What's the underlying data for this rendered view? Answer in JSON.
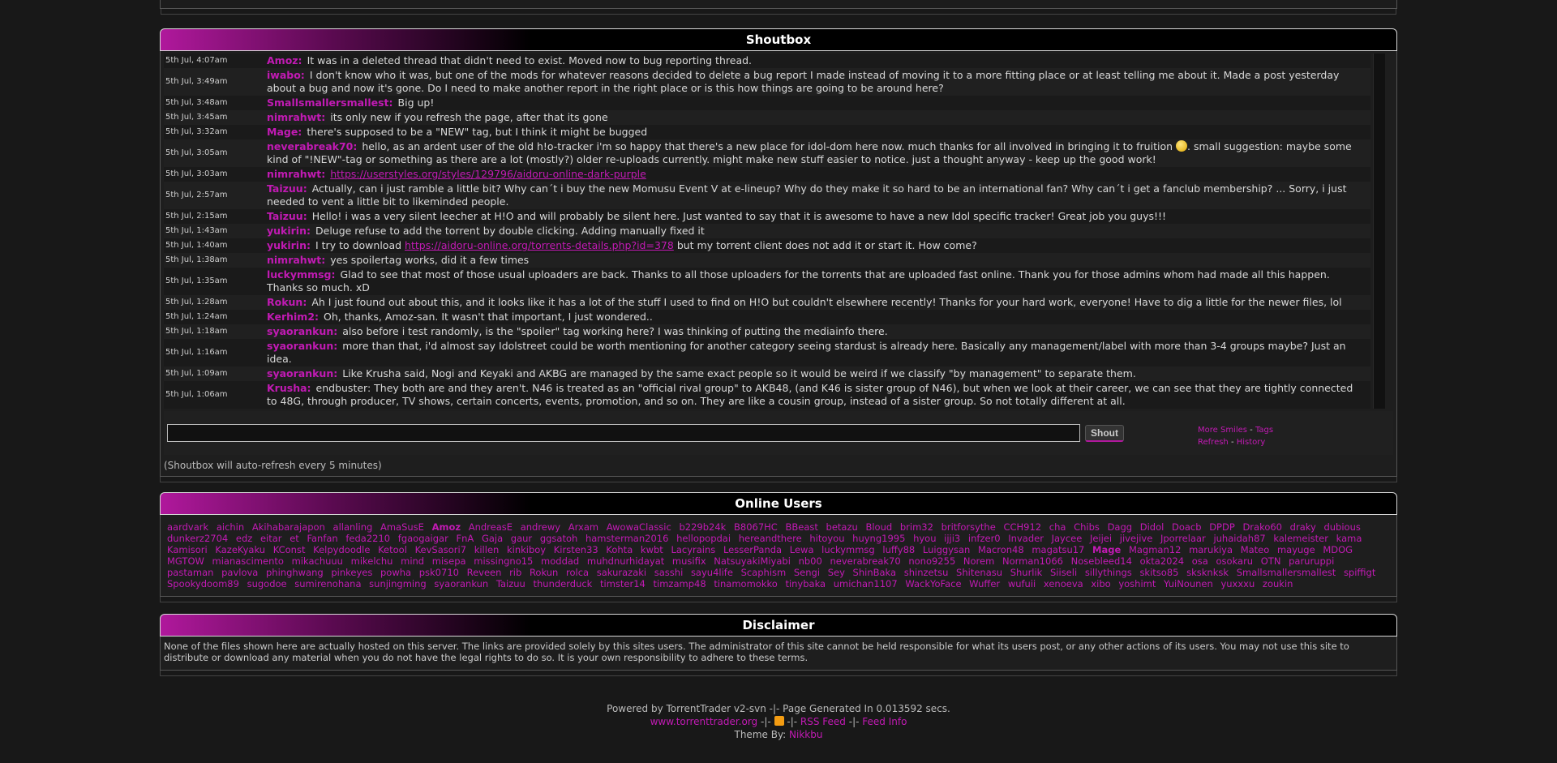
{
  "shoutbox": {
    "title": "Shoutbox",
    "messages": [
      {
        "time": "5th Jul, 4:07am",
        "user": "Amoz:",
        "text": "It was in a deleted thread that didn't need to exist. Moved now to bug reporting thread."
      },
      {
        "time": "5th Jul, 3:49am",
        "user": "iwabo:",
        "text": "I don't know who it was, but one of the mods for whatever reasons decided to delete a bug report I made instead of moving it to a more fitting place or at least telling me about it. Made a post yesterday about a bug and now it's gone. Do I need to make another report in the right place or is this how things are going to be around here?"
      },
      {
        "time": "5th Jul, 3:48am",
        "user": "Smallsmallersmallest:",
        "text": "Big up!"
      },
      {
        "time": "5th Jul, 3:45am",
        "user": "nimrahwt:",
        "text": "its only new if you refresh the page, after that its gone"
      },
      {
        "time": "5th Jul, 3:32am",
        "user": "Mage:",
        "text": "there's supposed to be a \"NEW\" tag, but I think it might be bugged"
      },
      {
        "time": "5th Jul, 3:05am",
        "user": "neverabreak70:",
        "text": "hello, as an ardent user of the old h!o-tracker i'm so happy that there's a new place for idol-dom here now. much thanks for all involved in bringing it to fruition",
        "text_after": ". small suggestion: maybe some kind of \"!NEW\"-tag or something as there are a lot (mostly?) older re-uploads currently. might make new stuff easier to notice. just a thought anyway - keep up the good work!"
      },
      {
        "time": "5th Jul, 3:03am",
        "user": "nimrahwt:",
        "link": "https://userstyles.org/styles/129796/aidoru-online-dark-purple"
      },
      {
        "time": "5th Jul, 2:57am",
        "user": "Taizuu:",
        "text": "Actually, can i just ramble a little bit? Why can´t i buy the new Momusu Event V at e-lineup? Why do they make it so hard to be an international fan? Why can´t i get a fanclub membership? ... Sorry, i just needed to vent a little bit to likeminded people."
      },
      {
        "time": "5th Jul, 2:15am",
        "user": "Taizuu:",
        "text": "Hello! i was a very silent leecher at H!O and will probably be silent here. Just wanted to say that it is awesome to have a new Idol specific tracker! Great job you guys!!!"
      },
      {
        "time": "5th Jul, 1:43am",
        "user": "yukirin:",
        "text": "Deluge refuse to add the torrent by double clicking. Adding manually fixed it"
      },
      {
        "time": "5th Jul, 1:40am",
        "user": "yukirin:",
        "text": "I try to download",
        "link": "https://aidoru-online.org/torrents-details.php?id=378",
        "text_after": "but my torrent client does not add it or start it. How come?"
      },
      {
        "time": "5th Jul, 1:38am",
        "user": "nimrahwt:",
        "text": "yes spoilertag works, did it a few times"
      },
      {
        "time": "5th Jul, 1:35am",
        "user": "luckymmsg:",
        "text": "Glad to see that most of those usual uploaders are back. Thanks to all those uploaders for the torrents that are uploaded fast online. Thank you for those admins whom had made all this happen. Thanks so much. xD"
      },
      {
        "time": "5th Jul, 1:28am",
        "user": "Rokun:",
        "text": "Ah I just found out about this, and it looks like it has a lot of the stuff I used to find on H!O but couldn't elsewhere recently! Thanks for your hard work, everyone! Have to dig a little for the newer files, lol"
      },
      {
        "time": "5th Jul, 1:24am",
        "user": "Kerhim2:",
        "text": "Oh, thanks, Amoz-san. It wasn't that important, I just wondered.."
      },
      {
        "time": "5th Jul, 1:18am",
        "user": "syaorankun:",
        "text": "also before i test randomly, is the \"spoiler\" tag working here? I was thinking of putting the mediainfo there."
      },
      {
        "time": "5th Jul, 1:16am",
        "user": "syaorankun:",
        "text": "more than that, i'd almost say Idolstreet could be worth mentioning for another category seeing stardust is already here. Basically any management/label with more than 3-4 groups maybe? Just an idea."
      },
      {
        "time": "5th Jul, 1:09am",
        "user": "syaorankun:",
        "text": "Like Krusha said, Nogi and Keyaki and AKBG are managed by the same exact people so it would be weird if we classify \"by management\" to separate them."
      },
      {
        "time": "5th Jul, 1:06am",
        "user": "Krusha:",
        "text": "endbuster: They both are and they aren't. N46 is treated as an \"official rival group\" to AKB48, (and K46 is sister group of N46), but when we look at their career, we can see that they are tightly connected to 48G, through producer, TV shows, certain concerts, events, promotion, and so on. They are like a cousin group, instead of a sister group. So not totally different at all."
      }
    ],
    "shout_button": "Shout",
    "links": {
      "more_smiles": "More Smiles",
      "dash1": "-",
      "tags": "Tags",
      "refresh": "Refresh",
      "dash2": "-",
      "history": "History"
    },
    "note": "(Shoutbox will auto-refresh every 5 minutes)"
  },
  "online_users": {
    "title": "Online Users",
    "users": [
      "aardvark",
      "aichin",
      "Akihabarajapon",
      "allanling",
      "AmaSusE",
      "Amoz",
      "AndreasE",
      "andrewy",
      "Arxam",
      "AwowaClassic",
      "b229b24k",
      "B8067HC",
      "BBeast",
      "betazu",
      "Bloud",
      "brim32",
      "britforsythe",
      "CCH912",
      "cha",
      "Chibs",
      "Dagg",
      "Didol",
      "Doacb",
      "DPDP",
      "Drako60",
      "draky",
      "dubious",
      "dunkerz2704",
      "edz",
      "eitar",
      "et",
      "Fanfan",
      "feda2210",
      "fgaogaigar",
      "FnA",
      "Gaja",
      "gaur",
      "ggsatoh",
      "hamsterman2016",
      "hellopopdai",
      "hereandthere",
      "hitoyou",
      "huyng1995",
      "hyou",
      "ijji3",
      "infzer0",
      "Invader",
      "Jaycee",
      "Jeijei",
      "jivejive",
      "Jporrelaar",
      "juhaidah87",
      "kalemeister",
      "kama",
      "Kamisori",
      "KazeKyaku",
      "KConst",
      "Kelpydoodle",
      "Ketool",
      "KevSasori7",
      "killen",
      "kinkiboy",
      "Kirsten33",
      "Kohta",
      "kwbt",
      "Lacyrains",
      "LesserPanda",
      "Lewa",
      "luckymmsg",
      "luffy88",
      "Luiggysan",
      "Macron48",
      "magatsu17",
      "Mage",
      "Magman12",
      "marukiya",
      "Mateo",
      "mayuge",
      "MDOG",
      "MGTOW",
      "mianascimento",
      "mikachuuu",
      "mikelchu",
      "mind",
      "misepa",
      "missingno15",
      "moddad",
      "muhdnurhidayat",
      "musifix",
      "NatsuyakiMiyabi",
      "nb00",
      "neverabreak70",
      "nono9255",
      "Norem",
      "Norman1066",
      "Nosebleed14",
      "okta2024",
      "osa",
      "osokaru",
      "OTN",
      "paruruppi",
      "pastaman",
      "pavlova",
      "phinghwang",
      "pinkeyes",
      "powha",
      "psk0710",
      "Reveen",
      "rib",
      "Rokun",
      "rolca",
      "sakurazaki",
      "sasshi",
      "sayu4life",
      "Scaphism",
      "Sengi",
      "Sey",
      "ShinBaka",
      "shinzetsu",
      "Shitenasu",
      "Shurlik",
      "Siiseli",
      "sillythings",
      "skitso85",
      "sksknksk",
      "Smallsmallersmallest",
      "spiffigt",
      "Spookydoom89",
      "sugodoe",
      "sumirenohana",
      "sunjingming",
      "syaorankun",
      "Taizuu",
      "thunderduck",
      "timster14",
      "timzamp48",
      "tinamomokko",
      "tinybaka",
      "umichan1107",
      "WackYoFace",
      "Wuffer",
      "wufuii",
      "xenoeva",
      "xibo",
      "yoshimt",
      "YuiNounen",
      "yuxxxu",
      "zoukin"
    ],
    "bold_users": [
      "Amoz",
      "Mage"
    ]
  },
  "disclaimer": {
    "title": "Disclaimer",
    "text": "None of the files shown here are actually hosted on this server. The links are provided solely by this sites users. The administrator of this site cannot be held responsible for what its users post, or any other actions of its users. You may not use this site to distribute or download any material when you do not have the legal rights to do so. It is your own responsibility to adhere to these terms."
  },
  "footer": {
    "powered": "Powered by TorrentTrader v2-svn -|- Page Generated In 0.013592 secs.",
    "site_link": "www.torrenttrader.org",
    "sep1": "-|-",
    "sep2": "-|-",
    "rss_feed": "RSS Feed",
    "sep3": "-|-",
    "feed_info": "Feed Info",
    "theme_by": "Theme By:",
    "theme_author": "Nikkbu"
  },
  "colors": {
    "accent": "#c21ab4",
    "background": "#181818"
  }
}
